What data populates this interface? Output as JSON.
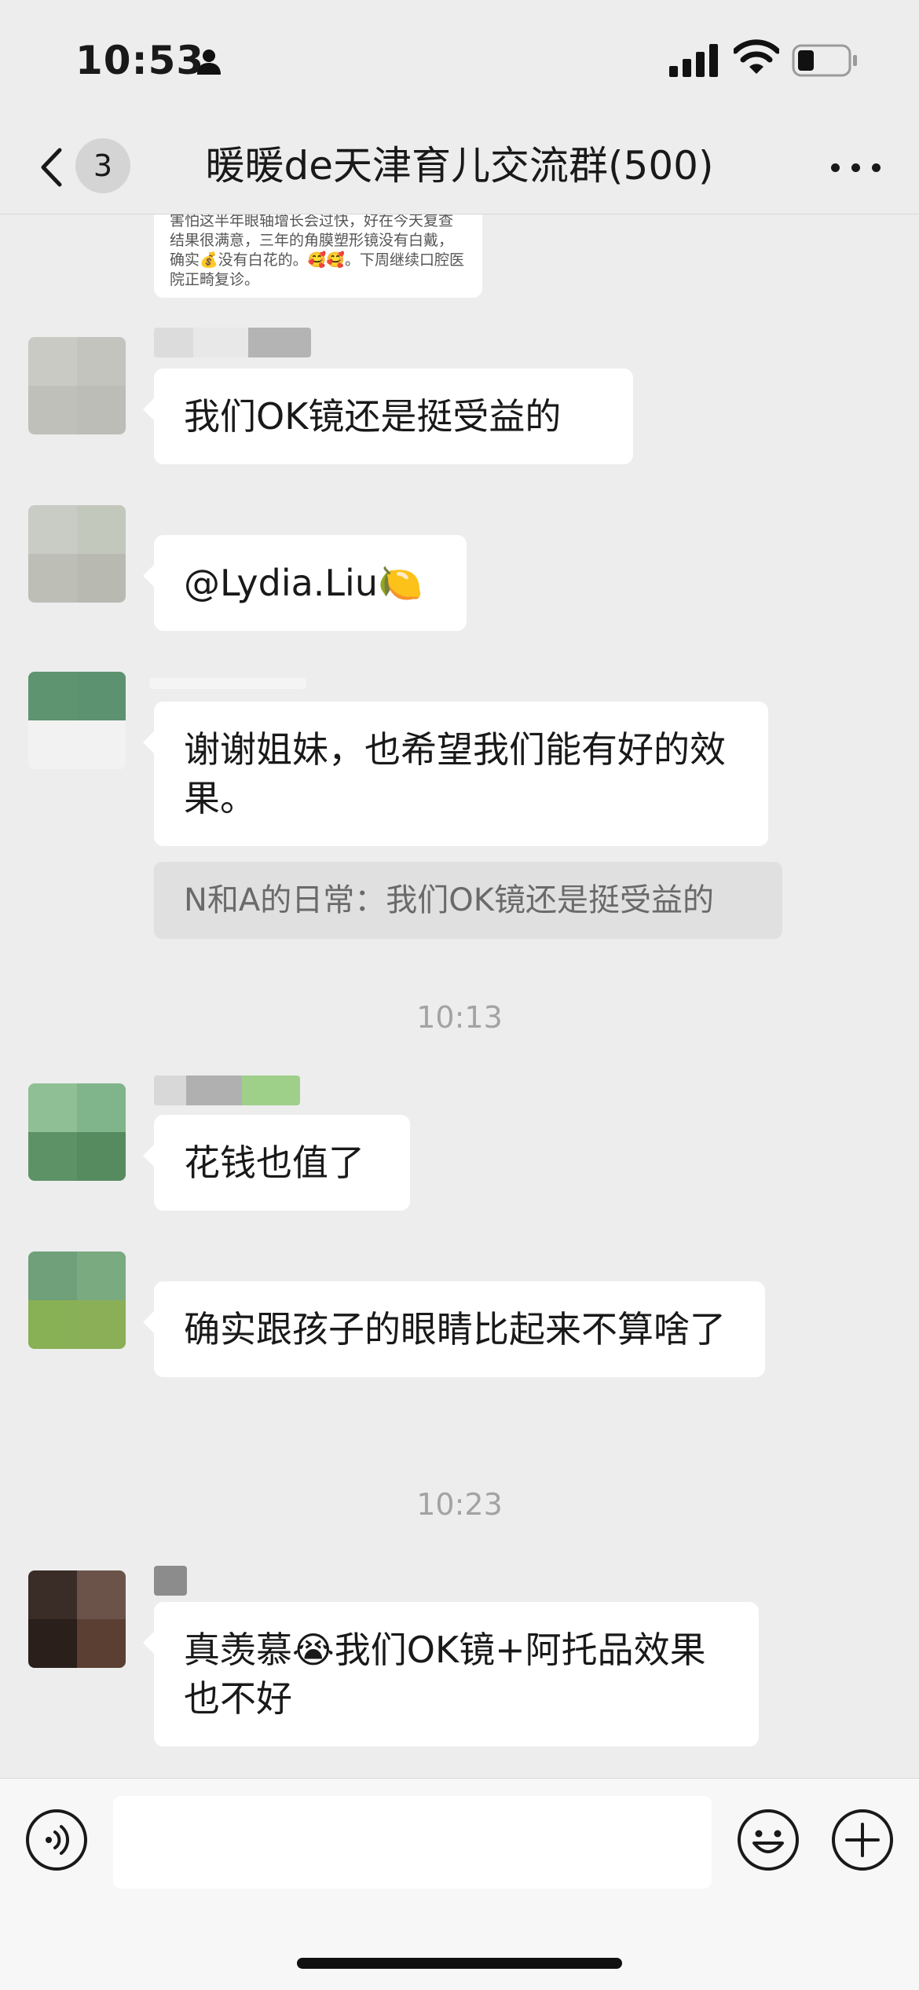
{
  "status_bar": {
    "time": "10:53"
  },
  "nav": {
    "back_badge": "3",
    "title": "暖暖de天津育儿交流群(500)"
  },
  "image_card": {
    "text": "害怕这半年眼轴增长会过快，好在今天复查结果很满意，三年的角膜塑形镜没有白戴，确实💰没有白花的。🥰🥰。下周继续口腔医院正畸复诊。"
  },
  "messages": [
    {
      "text": "我们OK镜还是挺受益的"
    },
    {
      "text": "@Lydia.Liu🍋"
    },
    {
      "text": "谢谢姐妹，也希望我们能有好的效果。",
      "quote": "N和A的日常：我们OK镜还是挺受益的"
    },
    {
      "text": "花钱也值了"
    },
    {
      "text": "确实跟孩子的眼睛比起来不算啥了"
    },
    {
      "text": "真羡慕😭我们OK镜+阿托品效果也不好"
    }
  ],
  "timestamps": [
    "10:13",
    "10:23"
  ],
  "input": {
    "value": ""
  },
  "colors": {
    "background": "#ededed",
    "bubble": "#ffffff",
    "quote_bg": "#e0e0e0",
    "timestamp": "#a3a3a3"
  },
  "icons": [
    "person-icon",
    "signal-icon",
    "wifi-icon",
    "battery-icon",
    "back-chevron-icon",
    "more-icon",
    "voice-icon",
    "emoji-icon",
    "plus-icon"
  ]
}
